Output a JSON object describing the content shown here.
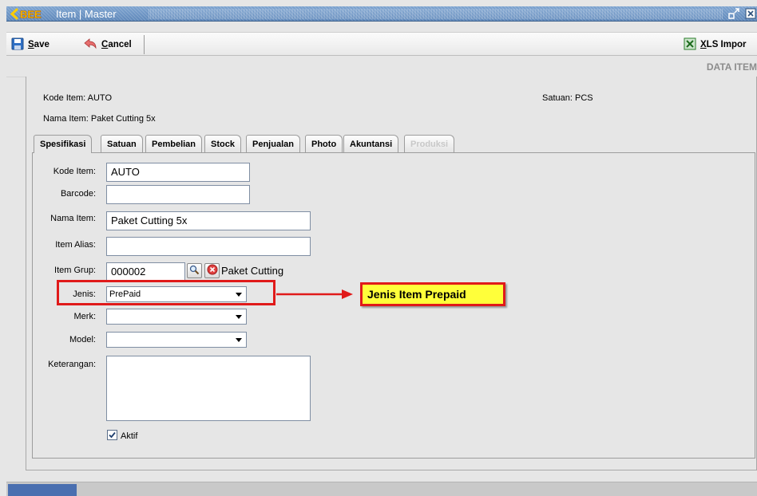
{
  "window": {
    "title": "Item | Master",
    "logo_text": "BEE"
  },
  "toolbar": {
    "save_label": "Save",
    "cancel_label": "Cancel",
    "xls_label": "XLS Impor"
  },
  "header": {
    "section_title": "DATA ITEM",
    "kode_item_label": "Kode Item:",
    "kode_item_value": "AUTO",
    "nama_item_label": "Nama Item:",
    "nama_item_value": "Paket Cutting 5x",
    "satuan_label": "Satuan:",
    "satuan_value": "PCS"
  },
  "tabs": [
    {
      "label": "Spesifikasi",
      "state": "active"
    },
    {
      "label": "Satuan",
      "state": "normal"
    },
    {
      "label": "Pembelian",
      "state": "normal"
    },
    {
      "label": "Stock",
      "state": "normal"
    },
    {
      "label": "Penjualan",
      "state": "normal"
    },
    {
      "label": "Photo",
      "state": "normal"
    },
    {
      "label": "Akuntansi",
      "state": "normal"
    },
    {
      "label": "Produksi",
      "state": "disabled"
    }
  ],
  "form": {
    "kode_item": {
      "label": "Kode Item:",
      "value": "AUTO"
    },
    "barcode": {
      "label": "Barcode:",
      "value": ""
    },
    "nama_item": {
      "label": "Nama Item:",
      "value": "Paket Cutting 5x"
    },
    "item_alias": {
      "label": "Item Alias:",
      "value": ""
    },
    "item_grup": {
      "label": "Item Grup:",
      "value": "000002",
      "description": "Paket Cutting"
    },
    "jenis": {
      "label": "Jenis:",
      "value": "PrePaid"
    },
    "merk": {
      "label": "Merk:",
      "value": ""
    },
    "model": {
      "label": "Model:",
      "value": ""
    },
    "keterangan": {
      "label": "Keterangan:",
      "value": ""
    },
    "aktif": {
      "label": "Aktif",
      "checked": true
    }
  },
  "annotation": {
    "callout_text": "Jenis Item Prepaid",
    "color": "#e01a1a",
    "fill": "#ffff3a"
  },
  "icons": {
    "save": "floppy-disk-icon",
    "cancel": "undo-arrow-icon",
    "xls": "excel-icon",
    "search": "magnifier-icon",
    "clear": "red-x-circle-icon",
    "restore": "restore-window-icon",
    "close": "close-window-icon"
  }
}
